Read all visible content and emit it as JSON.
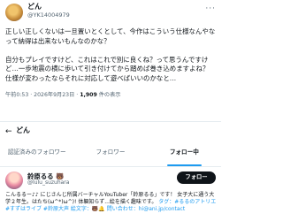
{
  "tweet": {
    "display_name": "どん",
    "handle": "@YK14004979",
    "body": "正しい正しくないは一旦置いとくとして、今作はこういう仕様なんやなって納得は出来ないもんなのかな？\n\n自分もプレイですけど、これはこれで別に良くね？って思うんですけど…一歩地震の横に歩いて引き付けてから踏めば巻き込めますよね？\n仕様が変わったならそれに対応して遊べばいいのかなと…",
    "time": "午前0:53 · 2026年9月23日 · ",
    "views_count": "1,909",
    "views_label": " 件の表示"
  },
  "profile_header": {
    "name": "どん"
  },
  "tabs": [
    {
      "label": "認証済みのフォロワー"
    },
    {
      "label": "フォロワー"
    },
    {
      "label": "フォロー中"
    }
  ],
  "suggested_user": {
    "name": "鈴原るる 🐻",
    "handle": "@lulu_suzuhara",
    "follow_label": "フォロー",
    "bio_text": "こんるるー♪♪ にじさんじ所属バーチャルYouTuber「鈴原るる」です！ 女子大に通う大学２年生。はたち(ω^*)ω^)! 体軀知らず...絵を描く趣味です。",
    "bio_links": "タグ：#るるのアトリエ #すずはライブ #鈴原大声 絵文字：🐻🔔 問い合わせ：hi@ani.jp/contact"
  },
  "colors": {
    "accent": "#1d9bf0",
    "text": "#0f1419",
    "muted": "#536471",
    "divider": "#e6ecf0"
  }
}
